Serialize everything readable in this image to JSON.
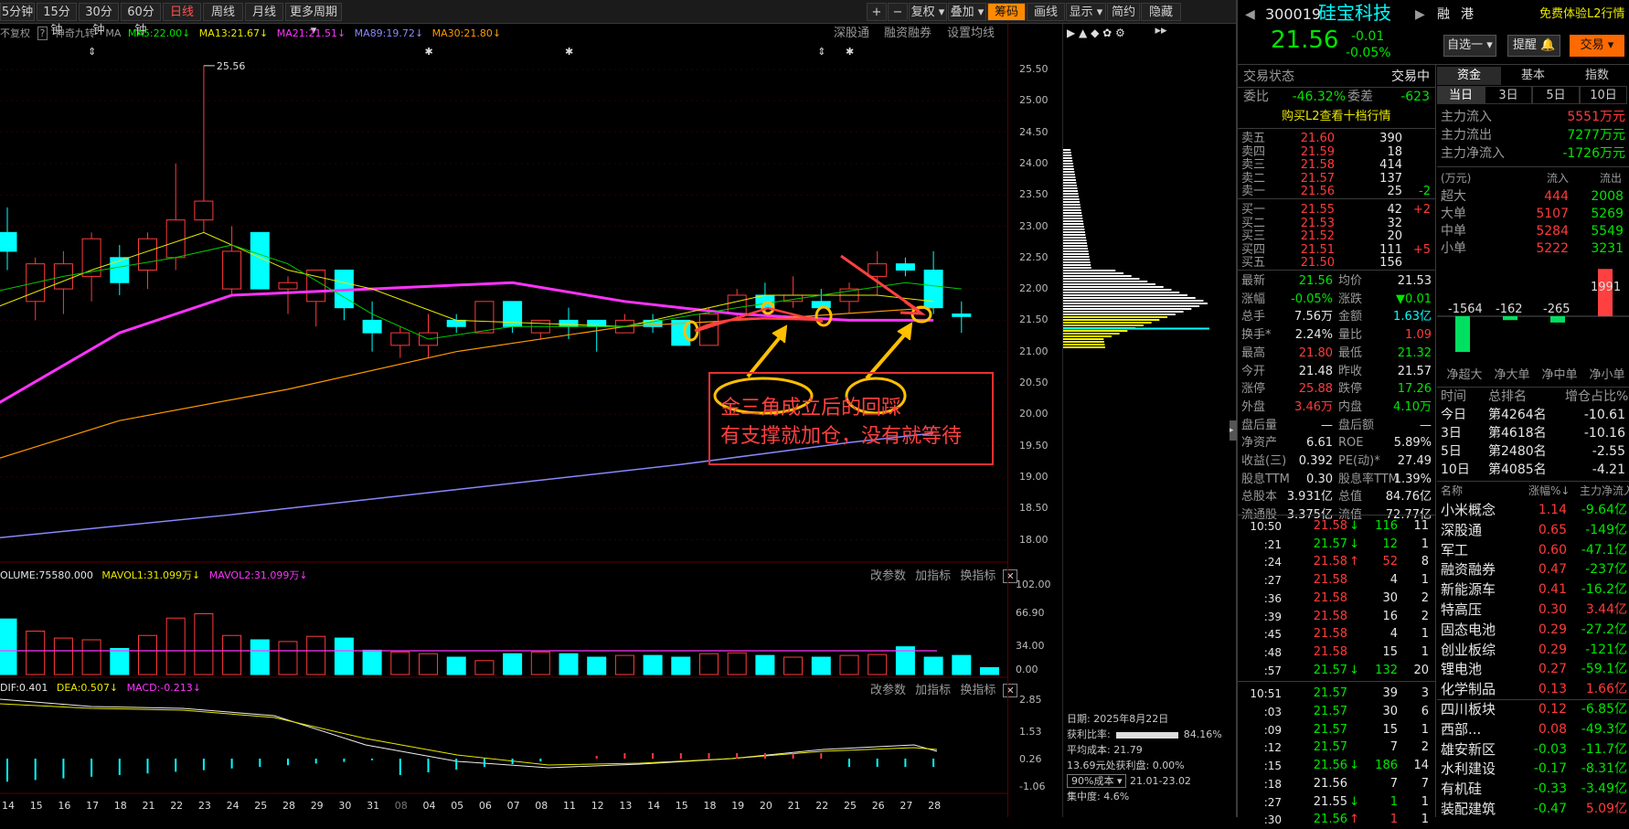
{
  "toolbar": {
    "periods": [
      "5分钟",
      "15分钟",
      "30分钟",
      "60分钟",
      "日线",
      "周线",
      "月线",
      "更多周期"
    ],
    "active": "日线",
    "right": [
      "+",
      "−",
      "复权",
      "叠加",
      "筹码",
      "画线",
      "显示",
      "简约",
      "隐藏"
    ],
    "active_right": "筹码"
  },
  "indicators": {
    "main": "不复权",
    "main_help": "?",
    "formula": "神奇九转",
    "ma": "MA",
    "ma5": "MA5:22.00",
    "ma13": "MA13:21.67",
    "ma21": "MA21:21.51",
    "ma89": "MA89:19.72",
    "ma30": "MA30:21.80",
    "links": [
      "深股通",
      "融资融券",
      "设置均线"
    ],
    "vol": "OLUME:75580.000",
    "mavol1": "MAVOL1:31.099万",
    "mavol2": "MAVOL2:31.099万",
    "macd_dif": "DIF:0.401",
    "macd_dea": "DEA:0.507",
    "macd": "MACD:-0.213",
    "panel_links": [
      "改参数",
      "加指标",
      "换指标"
    ]
  },
  "price_axis": [
    "25.50",
    "25.00",
    "24.50",
    "24.00",
    "23.50",
    "23.00",
    "22.50",
    "22.00",
    "21.50",
    "21.00",
    "20.50",
    "20.00",
    "19.50",
    "19.00",
    "18.50",
    "18.00"
  ],
  "vol_axis": [
    "102.00",
    "66.90",
    "34.00",
    "0.00"
  ],
  "macd_axis": [
    "2.85",
    "1.53",
    "0.26",
    "-1.06"
  ],
  "dates": [
    "14",
    "15",
    "16",
    "17",
    "18",
    "21",
    "22",
    "23",
    "24",
    "25",
    "28",
    "29",
    "30",
    "31",
    "08",
    "04",
    "05",
    "06",
    "07",
    "08",
    "11",
    "12",
    "13",
    "14",
    "15",
    "18",
    "19",
    "20",
    "21",
    "22",
    "25",
    "26",
    "27",
    "28"
  ],
  "max_label": "25.56",
  "annotation": {
    "line1": "金三角成立后的回踩",
    "line2": "有支撑就加仓，没有就等待"
  },
  "chip_info": {
    "date": "日期: 2025年8月22日",
    "profit_label": "获利比率:",
    "profit": "84.16%",
    "avg_label": "平均成本:",
    "avg": "21.79",
    "line": "13.69元处获利盘: 0.00%",
    "cost_select": "90%成本",
    "cost_range": "21.01-23.02",
    "conc_label": "集中度:",
    "conc": "4.6%"
  },
  "stock": {
    "code": "300019",
    "name": "硅宝科技",
    "price": "21.56",
    "change": "-0.01",
    "pct": "-0.05%",
    "badges": [
      "融",
      "港"
    ],
    "promo": "免费体验L2行情",
    "btns": [
      "自选一",
      "提醒",
      "交易"
    ]
  },
  "status": {
    "label": "交易状态",
    "value": "交易中",
    "weibi": "委比",
    "weibi_v": "-46.32%",
    "weicha": "委差",
    "weicha_v": "-623",
    "buy_l2": "购买L2查看十档行情"
  },
  "asks": [
    [
      "卖五",
      "21.60",
      "390",
      ""
    ],
    [
      "卖四",
      "21.59",
      "18",
      ""
    ],
    [
      "卖三",
      "21.58",
      "414",
      ""
    ],
    [
      "卖二",
      "21.57",
      "137",
      ""
    ],
    [
      "卖一",
      "21.56",
      "25",
      "-2"
    ]
  ],
  "bids": [
    [
      "买一",
      "21.55",
      "42",
      "+2"
    ],
    [
      "买二",
      "21.53",
      "32",
      ""
    ],
    [
      "买三",
      "21.52",
      "20",
      ""
    ],
    [
      "买四",
      "21.51",
      "111",
      "+5"
    ],
    [
      "买五",
      "21.50",
      "156",
      ""
    ]
  ],
  "quote": [
    [
      "最新",
      "21.56",
      "均价",
      "21.53"
    ],
    [
      "涨幅",
      "-0.05%",
      "涨跌",
      "▼0.01"
    ],
    [
      "总手",
      "7.56万",
      "金额",
      "1.63亿"
    ],
    [
      "换手*",
      "2.24%",
      "量比",
      "1.09"
    ],
    [
      "最高",
      "21.80",
      "最低",
      "21.32"
    ],
    [
      "今开",
      "21.48",
      "昨收",
      "21.57"
    ],
    [
      "涨停",
      "25.88",
      "跌停",
      "17.26"
    ],
    [
      "外盘",
      "3.46万",
      "内盘",
      "4.10万"
    ],
    [
      "盘后量",
      "—",
      "盘后额",
      "—"
    ],
    [
      "净资产",
      "6.61",
      "ROE",
      "5.89%"
    ],
    [
      "收益(三)",
      "0.392",
      "PE(动)*",
      "27.49"
    ],
    [
      "股息TTM",
      "0.30",
      "股息率TTM",
      "1.39%"
    ],
    [
      "总股本",
      "3.931亿",
      "总值",
      "84.76亿"
    ],
    [
      "流通股",
      "3.375亿",
      "流值",
      "72.77亿"
    ]
  ],
  "ticks": [
    [
      "10:50",
      "21.58",
      "↓",
      "116",
      "11"
    ],
    [
      ":21",
      "21.57",
      "↓",
      "12",
      "1"
    ],
    [
      ":24",
      "21.58",
      "↑",
      "52",
      "8"
    ],
    [
      ":27",
      "21.58",
      "",
      "4",
      "1"
    ],
    [
      ":36",
      "21.58",
      "",
      "30",
      "2"
    ],
    [
      ":39",
      "21.58",
      "",
      "16",
      "2"
    ],
    [
      ":45",
      "21.58",
      "",
      "4",
      "1"
    ],
    [
      ":48",
      "21.58",
      "",
      "15",
      "1"
    ],
    [
      ":57",
      "21.57",
      "↓",
      "132",
      "20"
    ],
    [
      "10:51",
      "21.57",
      "",
      "39",
      "3"
    ],
    [
      ":03",
      "21.57",
      "",
      "30",
      "6"
    ],
    [
      ":09",
      "21.57",
      "",
      "15",
      "1"
    ],
    [
      ":12",
      "21.57",
      "",
      "7",
      "2"
    ],
    [
      ":15",
      "21.56",
      "↓",
      "186",
      "14"
    ],
    [
      ":18",
      "21.56",
      "",
      "7",
      "7"
    ],
    [
      ":27",
      "21.55",
      "↓",
      "1",
      "1"
    ],
    [
      ":30",
      "21.56",
      "↑",
      "1",
      "1"
    ]
  ],
  "fund": {
    "tabs": [
      "资金",
      "基本",
      "指数"
    ],
    "subtabs": [
      "当日",
      "3日",
      "5日",
      "10日"
    ],
    "main": [
      [
        "主力流入",
        "5551万元"
      ],
      [
        "主力流出",
        "7277万元"
      ],
      [
        "主力净流入",
        "-1726万元"
      ]
    ],
    "unit": "(万元)",
    "in": "流入",
    "out": "流出",
    "rows": [
      [
        "超大",
        "444",
        "2008"
      ],
      [
        "大单",
        "5107",
        "5269"
      ],
      [
        "中单",
        "5284",
        "5549"
      ],
      [
        "小单",
        "5222",
        "3231"
      ]
    ],
    "bars": [
      "-1564",
      "-162",
      "-265",
      "1991"
    ],
    "bar_labels": [
      "净超大",
      "净大单",
      "净中单",
      "净小单"
    ]
  },
  "rank": {
    "head": [
      "时间",
      "总排名",
      "增仓占比%"
    ],
    "rows": [
      [
        "今日",
        "第4264名",
        "-10.61"
      ],
      [
        "3日",
        "第4618名",
        "-10.16"
      ],
      [
        "5日",
        "第2480名",
        "-2.55"
      ],
      [
        "10日",
        "第4085名",
        "-4.21"
      ]
    ]
  },
  "sectors": {
    "head": [
      "名称",
      "涨幅%",
      "主力净流入"
    ],
    "rows": [
      [
        "小米概念",
        "1.14",
        "-9.64亿"
      ],
      [
        "深股通",
        "0.65",
        "-149亿"
      ],
      [
        "军工",
        "0.60",
        "-47.1亿"
      ],
      [
        "融资融券",
        "0.47",
        "-237亿"
      ],
      [
        "新能源车",
        "0.41",
        "-16.2亿"
      ],
      [
        "特高压",
        "0.30",
        "3.44亿"
      ],
      [
        "固态电池",
        "0.29",
        "-27.2亿"
      ],
      [
        "创业板综",
        "0.29",
        "-121亿"
      ],
      [
        "锂电池",
        "0.27",
        "-59.1亿"
      ],
      [
        "化学制品",
        "0.13",
        "1.66亿"
      ],
      [
        "四川板块",
        "0.12",
        "-6.85亿"
      ],
      [
        "西部...",
        "0.08",
        "-49.3亿"
      ],
      [
        "雄安新区",
        "-0.03",
        "-11.7亿"
      ],
      [
        "水利建设",
        "-0.17",
        "-8.31亿"
      ],
      [
        "有机硅",
        "-0.33",
        "-3.49亿"
      ],
      [
        "装配建筑",
        "-0.47",
        "5.09亿"
      ]
    ]
  }
}
